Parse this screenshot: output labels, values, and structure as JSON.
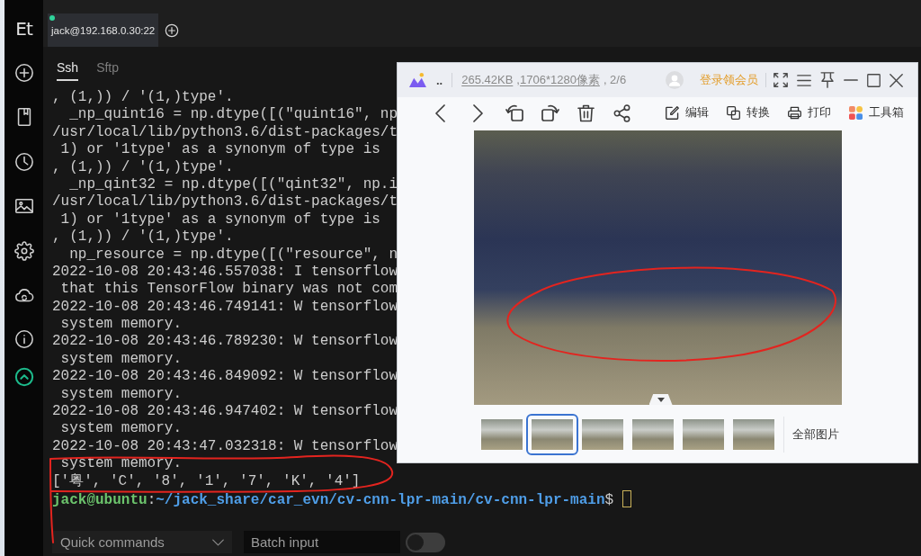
{
  "sidebar": {
    "logo": "Et"
  },
  "session_tabs": [
    {
      "label": "jack@192.168.0.30:22",
      "selected": true,
      "connected": true
    }
  ],
  "pane_tabs": [
    {
      "label": "Ssh",
      "selected": true
    },
    {
      "label": "Sftp",
      "selected": false
    }
  ],
  "terminal": {
    "lines": [
      ", (1,)) / '(1,)type'.",
      "  _np_quint16 = np.dtype([(\"quint16\", np",
      "/usr/local/lib/python3.6/dist-packages/t",
      " 1) or '1type' as a synonym of type is",
      ", (1,)) / '(1,)type'.",
      "  _np_qint32 = np.dtype([(\"qint32\", np.i",
      "/usr/local/lib/python3.6/dist-packages/t",
      " 1) or '1type' as a synonym of type is",
      ", (1,)) / '(1,)type'.",
      "  np_resource = np.dtype([(\"resource\", n",
      "2022-10-08 20:43:46.557038: I tensorflow",
      " that this TensorFlow binary was not com",
      "2022-10-08 20:43:46.749141: W tensorflow",
      " system memory.",
      "2022-10-08 20:43:46.789230: W tensorflow",
      " system memory.",
      "2022-10-08 20:43:46.849092: W tensorflow",
      " system memory.",
      "2022-10-08 20:43:46.947402: W tensorflow",
      " system memory.",
      "2022-10-08 20:43:47.032318: W tensorflow",
      " system memory.",
      "['粤', 'C', '8', '1', '7', 'K', '4']"
    ],
    "prompt": {
      "user_host": "jack@ubuntu",
      "separator": ":",
      "path": "~/jack_share/car_evn/cv-cnn-lpr-main/cv-cnn-lpr-main",
      "symbol": "$"
    }
  },
  "bottom_bar": {
    "quick_commands": {
      "placeholder": "Quick commands"
    },
    "batch_input": {
      "placeholder": "Batch input"
    },
    "batch_toggle": {
      "on": false
    }
  },
  "image_viewer": {
    "title": "..",
    "info": [
      {
        "text": "265.42KB",
        "link": true
      },
      {
        "text": ",",
        "link": false
      },
      {
        "text": "1706*1280像素",
        "link": true
      },
      {
        "text": ", 2/6",
        "link": false
      }
    ],
    "vip_link": "登录领会员",
    "actions": [
      {
        "kind": "edit",
        "label": "编辑"
      },
      {
        "kind": "convert",
        "label": "转换"
      },
      {
        "kind": "print",
        "label": "打印"
      },
      {
        "kind": "toolbox",
        "label": "工具箱"
      }
    ],
    "thumbnails": [
      {
        "selected": false
      },
      {
        "selected": true
      },
      {
        "selected": false
      },
      {
        "selected": false
      },
      {
        "selected": false
      },
      {
        "selected": false
      }
    ],
    "all_images": "全部图片"
  }
}
